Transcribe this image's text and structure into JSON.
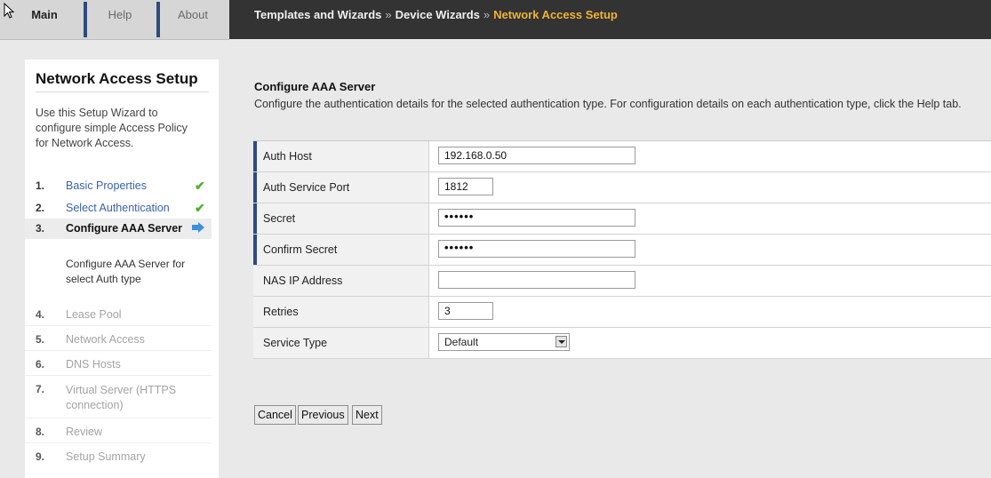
{
  "tabs": [
    "Main",
    "Help",
    "About"
  ],
  "breadcrumb": {
    "items": [
      "Templates and Wizards",
      "Device Wizards"
    ],
    "separator": "»",
    "current": "Network Access Setup"
  },
  "wizard": {
    "title": "Network Access Setup",
    "description": "Use this Setup Wizard to configure simple Access Policy for Network Access.",
    "steps": [
      {
        "num": "1.",
        "label": "Basic Properties",
        "state": "done"
      },
      {
        "num": "2.",
        "label": "Select Authentication",
        "state": "done"
      },
      {
        "num": "3.",
        "label": "Configure AAA Server",
        "state": "current"
      },
      {
        "num": "4.",
        "label": "Lease Pool",
        "state": "future"
      },
      {
        "num": "5.",
        "label": "Network Access",
        "state": "future"
      },
      {
        "num": "6.",
        "label": "DNS Hosts",
        "state": "future"
      },
      {
        "num": "7.",
        "label": "Virtual Server (HTTPS connection)",
        "state": "future"
      },
      {
        "num": "8.",
        "label": "Review",
        "state": "future"
      },
      {
        "num": "9.",
        "label": "Setup Summary",
        "state": "future"
      }
    ],
    "current_step_description": "Configure AAA Server for select Auth type"
  },
  "content": {
    "title": "Configure AAA Server",
    "description": "Configure the authentication details for the selected authentication type. For configuration details on each authentication type, click the Help tab."
  },
  "form": {
    "auth_host": {
      "label": "Auth Host",
      "value": "192.168.0.50"
    },
    "auth_service_port": {
      "label": "Auth Service Port",
      "value": "1812"
    },
    "secret": {
      "label": "Secret",
      "value": "••••••"
    },
    "confirm_secret": {
      "label": "Confirm Secret",
      "value": "••••••"
    },
    "nas_ip_address": {
      "label": "NAS IP Address",
      "value": ""
    },
    "retries": {
      "label": "Retries",
      "value": "3"
    },
    "service_type": {
      "label": "Service Type",
      "value": "Default"
    }
  },
  "buttons": {
    "cancel": "Cancel",
    "previous": "Previous",
    "next": "Next"
  },
  "colors": {
    "breadcrumb_bar": "#333333",
    "current_crumb": "#f2b233",
    "tab_separator": "#2e4a7f",
    "done_step": "#3a63a8",
    "check": "#4caf2d",
    "arrow": "#3b8fe0"
  },
  "icons": {
    "cursor": "pointer-cursor-icon",
    "check": "check-icon",
    "arrow": "right-arrow-icon"
  }
}
